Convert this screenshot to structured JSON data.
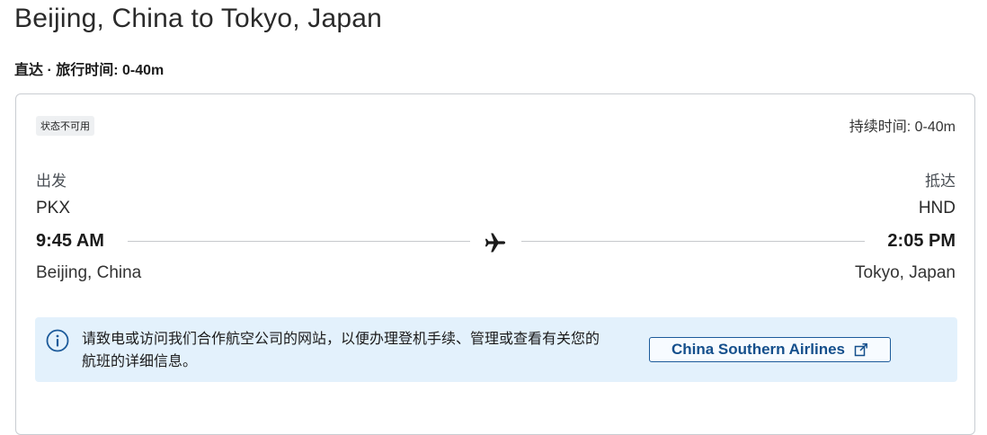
{
  "header": {
    "title": "Beijing, China to Tokyo, Japan",
    "subtitle": "直达 · 旅行时间: 0-40m"
  },
  "flight": {
    "status_badge": "状态不可用",
    "duration": "持续时间: 0-40m",
    "departure": {
      "label": "出发",
      "airport": "PKX",
      "time": "9:45 AM",
      "city": "Beijing, China"
    },
    "arrival": {
      "label": "抵达",
      "airport": "HND",
      "time": "2:05 PM",
      "city": "Tokyo, Japan"
    },
    "route_icon": "airplane-icon"
  },
  "notice": {
    "icon": "info-icon",
    "text": "请致电或访问我们合作航空公司的网站，以便办理登机手续、管理或查看有关您的航班的详细信息。",
    "airline_link_label": "China Southern Airlines",
    "link_icon": "external-link-icon"
  },
  "colors": {
    "accent": "#144f8c",
    "notice_bg": "#e3f1fc",
    "card_border": "#c9cdd2"
  }
}
